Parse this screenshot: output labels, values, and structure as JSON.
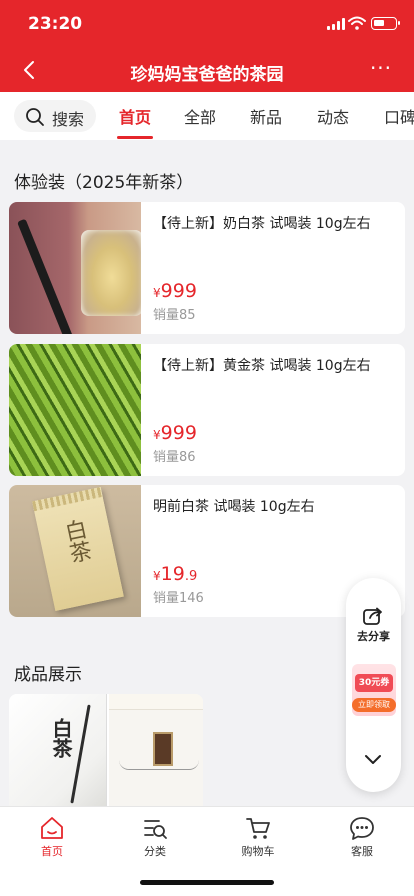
{
  "status": {
    "time": "23:20"
  },
  "header": {
    "title": "珍妈妈宝爸爸的茶园",
    "more": "···"
  },
  "nav": {
    "search_label": "搜索",
    "tabs": [
      "首页",
      "全部",
      "新品",
      "动态",
      "口碑"
    ],
    "active_tab": "首页"
  },
  "section_trial": {
    "title": "体验装（2025年新茶）",
    "products": [
      {
        "name": "【待上新】奶白茶 试喝装 10g左右",
        "currency": "¥",
        "price_int": "999",
        "price_dec": "",
        "sales": "销量85"
      },
      {
        "name": "【待上新】黄金茶 试喝装 10g左右",
        "currency": "¥",
        "price_int": "999",
        "price_dec": "",
        "sales": "销量86"
      },
      {
        "name": "明前白茶 试喝装 10g左右",
        "currency": "¥",
        "price_int": "19",
        "price_dec": ".9",
        "sales": "销量146"
      }
    ]
  },
  "section_display": {
    "title": "成品展示",
    "box1_calligraphy": "白茶"
  },
  "float_panel": {
    "share_label": "去分享",
    "coupon_value": "30元券",
    "coupon_button": "立即领取"
  },
  "tabbar": {
    "items": [
      {
        "label": "首页",
        "icon": "home-icon"
      },
      {
        "label": "分类",
        "icon": "category-icon"
      },
      {
        "label": "购物车",
        "icon": "cart-icon"
      },
      {
        "label": "客服",
        "icon": "chat-icon"
      }
    ]
  },
  "colors": {
    "brand_red": "#e5262b",
    "price_red": "#e5262b"
  }
}
